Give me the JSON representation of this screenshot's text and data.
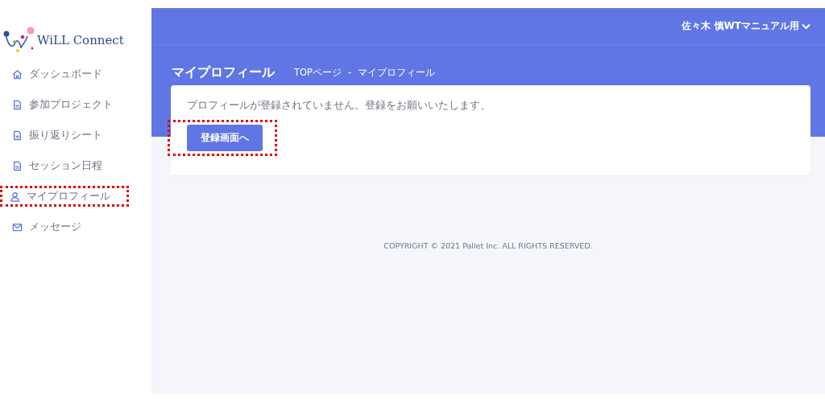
{
  "logo": {
    "text": "WiLL Connect"
  },
  "sidebar": {
    "items": [
      {
        "label": "ダッシュボード",
        "kind": "home",
        "annotated": false
      },
      {
        "label": "参加プロジェクト",
        "kind": "document",
        "annotated": false
      },
      {
        "label": "振り返りシート",
        "kind": "document",
        "annotated": false
      },
      {
        "label": "セッション日程",
        "kind": "document",
        "annotated": false
      },
      {
        "label": "マイプロフィール",
        "kind": "user",
        "annotated": true
      },
      {
        "label": "メッセージ",
        "kind": "mail",
        "annotated": false
      }
    ]
  },
  "header": {
    "user": "佐々木 慎WTマニュアル用"
  },
  "page": {
    "title": "マイプロフィール",
    "breadcrumb": [
      "TOPページ",
      "マイプロフィール"
    ],
    "separator": "-"
  },
  "card": {
    "message": "プロフィールが登録されていません。登録をお願いいたします、",
    "button": {
      "label": "登録画面へ",
      "annotated": true
    }
  },
  "footer": {
    "text": "COPYRIGHT © 2021 Pallet Inc. ALL RIGHTS RESERVED."
  }
}
